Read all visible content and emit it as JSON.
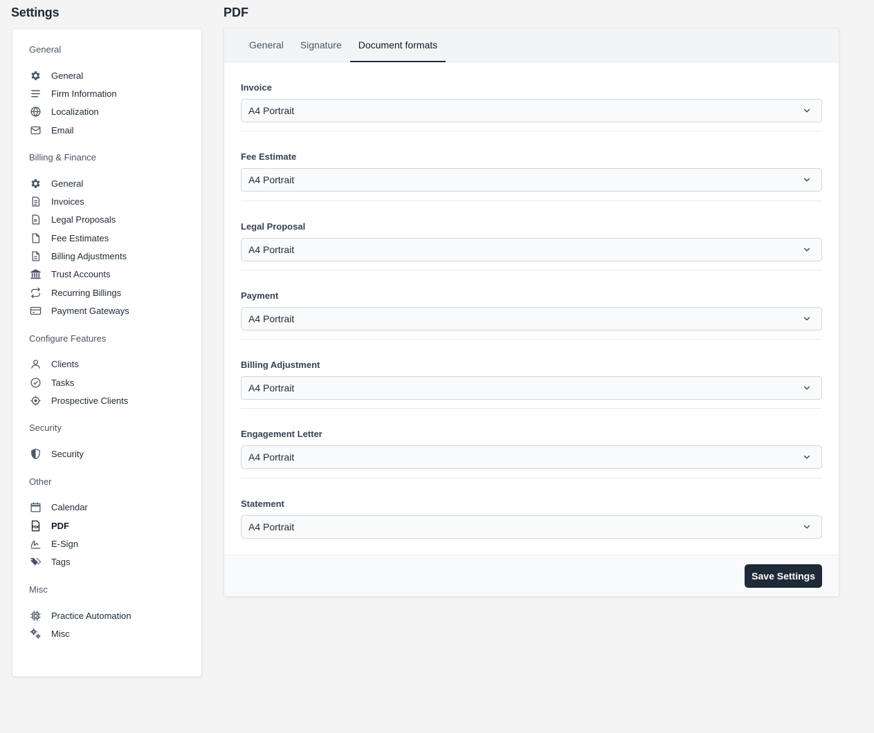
{
  "sidebar": {
    "title": "Settings",
    "groups": [
      {
        "title": "General",
        "items": [
          {
            "label": "General",
            "icon": "gear-icon"
          },
          {
            "label": "Firm Information",
            "icon": "lines-icon"
          },
          {
            "label": "Localization",
            "icon": "globe-icon"
          },
          {
            "label": "Email",
            "icon": "envelope-icon"
          }
        ]
      },
      {
        "title": "Billing & Finance",
        "items": [
          {
            "label": "General",
            "icon": "gear-icon"
          },
          {
            "label": "Invoices",
            "icon": "invoice-icon"
          },
          {
            "label": "Legal Proposals",
            "icon": "proposal-doc-icon"
          },
          {
            "label": "Fee Estimates",
            "icon": "file-icon"
          },
          {
            "label": "Billing Adjustments",
            "icon": "doc-lines-icon"
          },
          {
            "label": "Trust Accounts",
            "icon": "bank-icon"
          },
          {
            "label": "Recurring Billings",
            "icon": "repeat-icon"
          },
          {
            "label": "Payment Gateways",
            "icon": "credit-card-icon"
          }
        ]
      },
      {
        "title": "Configure Features",
        "items": [
          {
            "label": "Clients",
            "icon": "user-icon"
          },
          {
            "label": "Tasks",
            "icon": "check-circle-icon"
          },
          {
            "label": "Prospective Clients",
            "icon": "crosshair-icon"
          }
        ]
      },
      {
        "title": "Security",
        "items": [
          {
            "label": "Security",
            "icon": "shield-icon"
          }
        ]
      },
      {
        "title": "Other",
        "items": [
          {
            "label": "Calendar",
            "icon": "calendar-icon"
          },
          {
            "label": "PDF",
            "icon": "pdf-icon",
            "active": true
          },
          {
            "label": "E-Sign",
            "icon": "signature-icon"
          },
          {
            "label": "Tags",
            "icon": "tags-icon"
          }
        ]
      },
      {
        "title": "Misc",
        "items": [
          {
            "label": "Practice Automation",
            "icon": "chip-icon"
          },
          {
            "label": "Misc",
            "icon": "gears-icon"
          }
        ]
      }
    ]
  },
  "page": {
    "title": "PDF",
    "tabs": [
      {
        "label": "General",
        "active": false
      },
      {
        "label": "Signature",
        "active": false
      },
      {
        "label": "Document formats",
        "active": true
      }
    ],
    "fields": [
      {
        "label": "Invoice",
        "value": "A4 Portrait"
      },
      {
        "label": "Fee Estimate",
        "value": "A4 Portrait"
      },
      {
        "label": "Legal Proposal",
        "value": "A4 Portrait"
      },
      {
        "label": "Payment",
        "value": "A4 Portrait"
      },
      {
        "label": "Billing Adjustment",
        "value": "A4 Portrait"
      },
      {
        "label": "Engagement Letter",
        "value": "A4 Portrait"
      },
      {
        "label": "Statement",
        "value": "A4 Portrait"
      }
    ],
    "save_label": "Save Settings"
  }
}
